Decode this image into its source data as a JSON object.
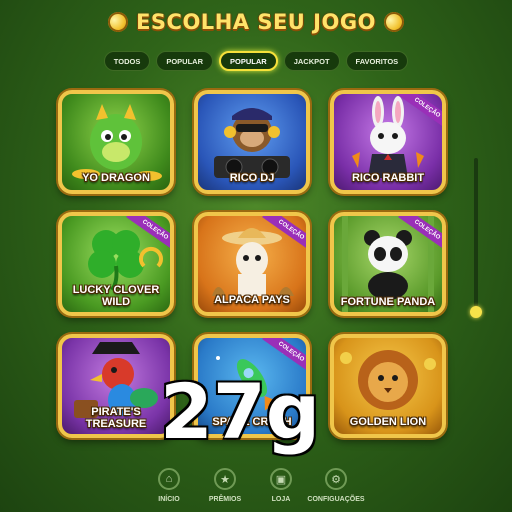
{
  "header": {
    "title": "ESCOLHA SEU JOGO",
    "left_icon": "coin-icon",
    "right_icon": "coin-icon"
  },
  "tabs": [
    {
      "label": "TODOS",
      "active": false
    },
    {
      "label": "POPULAR",
      "active": false
    },
    {
      "label": "POPULAR",
      "active": true
    },
    {
      "label": "JACKPOT",
      "active": false
    },
    {
      "label": "FAVORITOS",
      "active": false
    }
  ],
  "games": [
    {
      "title": "YO DRAGON",
      "ribbon": "",
      "art": "dragon"
    },
    {
      "title": "RICO DJ",
      "ribbon": "",
      "art": "monkey-dj"
    },
    {
      "title": "RICO RABBIT",
      "ribbon": "COLEÇÃO",
      "art": "rabbit"
    },
    {
      "title": "LUCKY CLOVER WILD",
      "ribbon": "COLEÇÃO",
      "art": "clover"
    },
    {
      "title": "ALPACA PAYS",
      "ribbon": "COLEÇÃO",
      "art": "alpaca"
    },
    {
      "title": "FORTUNE PANDA",
      "ribbon": "COLEÇÃO",
      "art": "panda"
    },
    {
      "title": "PIRATE'S TREASURE",
      "ribbon": "",
      "art": "parrot"
    },
    {
      "title": "SPACE CRASH",
      "ribbon": "COLEÇÃO",
      "art": "rocket"
    },
    {
      "title": "GOLDEN LION",
      "ribbon": "",
      "art": "lion"
    }
  ],
  "overlay_text": "27g",
  "nav": [
    {
      "label": "INÍCIO",
      "icon": "home-icon"
    },
    {
      "label": "PRÊMIOS",
      "icon": "trophy-icon"
    },
    {
      "label": "LOJA",
      "icon": "shop-icon"
    },
    {
      "label": "CONFIGUAÇÕES",
      "icon": "gear-icon"
    }
  ],
  "colors": {
    "accent": "#f6e13a",
    "frame": "#f0c64a",
    "ribbon": "#9a2fb8"
  }
}
